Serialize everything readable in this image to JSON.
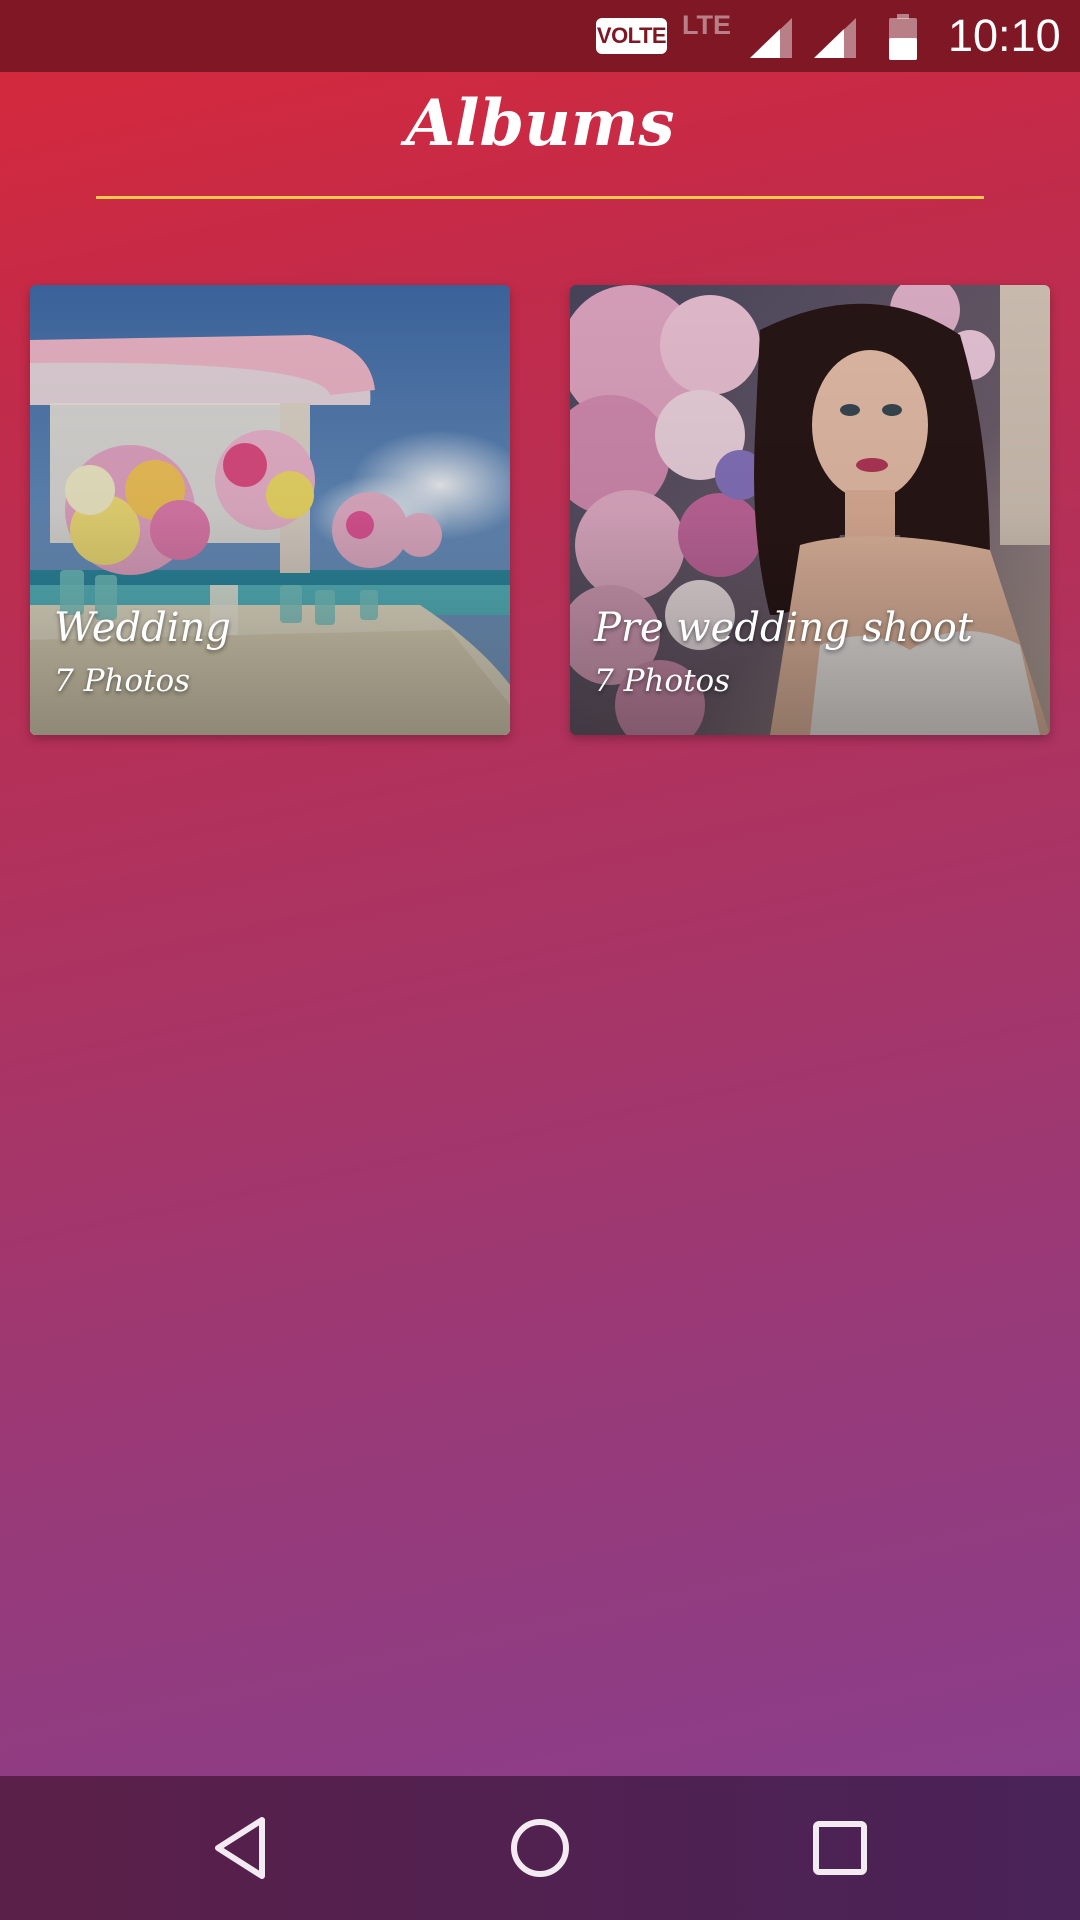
{
  "status_bar": {
    "volte": "VOLTE",
    "network": "LTE",
    "time": "10:10",
    "battery_level": 0.5
  },
  "header": {
    "title": "Albums",
    "underline_color": "#f2c94c"
  },
  "albums": [
    {
      "name": "Wedding",
      "count": "7 Photos",
      "image": "wedding-table-flowers"
    },
    {
      "name": "Pre wedding shoot",
      "count": "7 Photos",
      "image": "portrait-woman-flowers"
    }
  ],
  "nav_bar": {
    "icons": [
      "back-icon",
      "home-icon",
      "recents-icon"
    ]
  },
  "colors": {
    "status_bar": "#7f1824",
    "gradient_top": "#d8283a",
    "gradient_bottom": "#863f8f",
    "nav_bar": "#4f2152"
  }
}
